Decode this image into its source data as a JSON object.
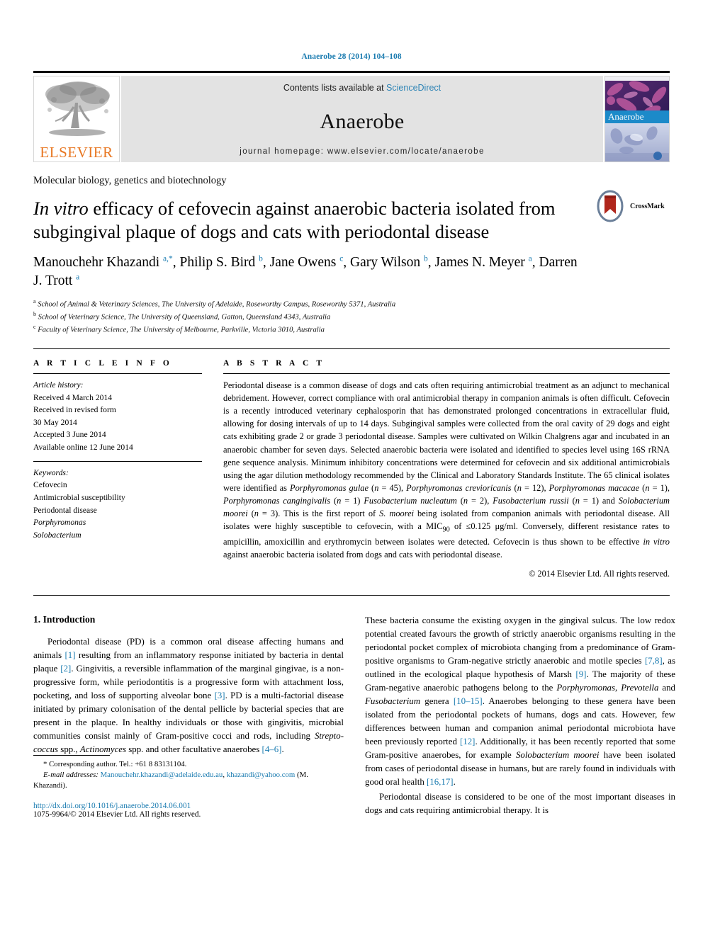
{
  "running_head": "Anaerobe 28 (2014) 104–108",
  "masthead": {
    "publisher": "ELSEVIER",
    "contents_prefix": "Contents lists available at ",
    "contents_link": "ScienceDirect",
    "journal_name": "Anaerobe",
    "homepage": "journal homepage: www.elsevier.com/locate/anaerobe",
    "cover_label": "Anaerobe"
  },
  "article": {
    "section_label": "Molecular biology, genetics and biotechnology",
    "title_part1": "In vitro",
    "title_part2": " efficacy of cefovecin against anaerobic bacteria isolated from subgingival plaque of dogs and cats with periodontal disease",
    "crossmark_label": "CrossMark",
    "authors": "Manouchehr Khazandi a,*, Philip S. Bird b, Jane Owens c, Gary Wilson b, James N. Meyer a, Darren J. Trott a",
    "affiliations": [
      "a School of Animal & Veterinary Sciences, The University of Adelaide, Roseworthy Campus, Roseworthy 5371, Australia",
      "b School of Veterinary Science, The University of Queensland, Gatton, Queensland 4343, Australia",
      "c Faculty of Veterinary Science, The University of Melbourne, Parkville, Victoria 3010, Australia"
    ]
  },
  "article_info": {
    "heading": "A R T I C L E  I N F O",
    "history_label": "Article history:",
    "history": [
      "Received 4 March 2014",
      "Received in revised form",
      "30 May 2014",
      "Accepted 3 June 2014",
      "Available online 12 June 2014"
    ],
    "keywords_label": "Keywords:",
    "keywords": [
      "Cefovecin",
      "Antimicrobial susceptibility",
      "Periodontal disease",
      "Porphyromonas",
      "Solobacterium"
    ]
  },
  "abstract": {
    "heading": "A B S T R A C T",
    "text": "Periodontal disease is a common disease of dogs and cats often requiring antimicrobial treatment as an adjunct to mechanical debridement. However, correct compliance with oral antimicrobial therapy in companion animals is often difficult. Cefovecin is a recently introduced veterinary cephalosporin that has demonstrated prolonged concentrations in extracellular fluid, allowing for dosing intervals of up to 14 days. Subgingival samples were collected from the oral cavity of 29 dogs and eight cats exhibiting grade 2 or grade 3 periodontal disease. Samples were cultivated on Wilkin Chalgrens agar and incubated in an anaerobic chamber for seven days. Selected anaerobic bacteria were isolated and identified to species level using 16S rRNA gene sequence analysis. Minimum inhibitory concentrations were determined for cefovecin and six additional antimicrobials using the agar dilution methodology recommended by the Clinical and Laboratory Standards Institute. The 65 clinical isolates were identified as Porphyromonas gulae (n = 45), Porphyromonas crevioricanis (n = 12), Porphyromonas macacae (n = 1), Porphyromonas cangingivalis (n = 1) Fusobacterium nucleatum (n = 2), Fusobacterium russii (n = 1) and Solobacterium moorei (n = 3). This is the first report of S. moorei being isolated from companion animals with periodontal disease. All isolates were highly susceptible to cefovecin, with a MIC90 of ≤0.125 μg/ml. Conversely, different resistance rates to ampicillin, amoxicillin and erythromycin between isolates were detected. Cefovecin is thus shown to be effective in vitro against anaerobic bacteria isolated from dogs and cats with periodontal disease.",
    "copyright": "© 2014 Elsevier Ltd. All rights reserved."
  },
  "intro": {
    "heading": "1. Introduction",
    "left_para": "Periodontal disease (PD) is a common oral disease affecting humans and animals [1] resulting from an inflammatory response initiated by bacteria in dental plaque [2]. Gingivitis, a reversible inflammation of the marginal gingivae, is a non-progressive form, while periodontitis is a progressive form with attachment loss, pocketing, and loss of supporting alveolar bone [3]. PD is a multi-factorial disease initiated by primary colonisation of the dental pellicle by bacterial species that are present in the plaque. In healthy individuals or those with gingivitis, microbial communities consist mainly of Gram-positive cocci and rods, including Streptococcus spp., Actinomyces spp. and other facultative anaerobes [4–6].",
    "right_para_1": "These bacteria consume the existing oxygen in the gingival sulcus. The low redox potential created favours the growth of strictly anaerobic organisms resulting in the periodontal pocket complex of microbiota changing from a predominance of Gram-positive organisms to Gram-negative strictly anaerobic and motile species [7,8], as outlined in the ecological plaque hypothesis of Marsh [9]. The majority of these Gram-negative anaerobic pathogens belong to the Porphyromonas, Prevotella and Fusobacterium genera [10–15]. Anaerobes belonging to these genera have been isolated from the periodontal pockets of humans, dogs and cats. However, few differences between human and companion animal periodontal microbiota have been previously reported [12]. Additionally, it has been recently reported that some Gram-positive anaerobes, for example Solobacterium moorei have been isolated from cases of periodontal disease in humans, but are rarely found in individuals with good oral health [16,17].",
    "right_para_2": "Periodontal disease is considered to be one of the most important diseases in dogs and cats requiring antimicrobial therapy. It is"
  },
  "footnote": {
    "corresponding": "* Corresponding author. Tel.: +61 8 83131104.",
    "email_label": "E-mail addresses:",
    "email_1": "Manouchehr.khazandi@adelaide.edu.au",
    "email_2": "khazandi@yahoo.com",
    "email_suffix": " (M. Khazandi).",
    "doi": "http://dx.doi.org/10.1016/j.anaerobe.2014.06.001",
    "issn": "1075-9964/© 2014 Elsevier Ltd. All rights reserved."
  },
  "colors": {
    "link_blue": "#1a7bb0",
    "sciencedirect_blue": "#2e84b5",
    "elsevier_orange": "#e87722",
    "masthead_grey": "#e3e3e3"
  }
}
